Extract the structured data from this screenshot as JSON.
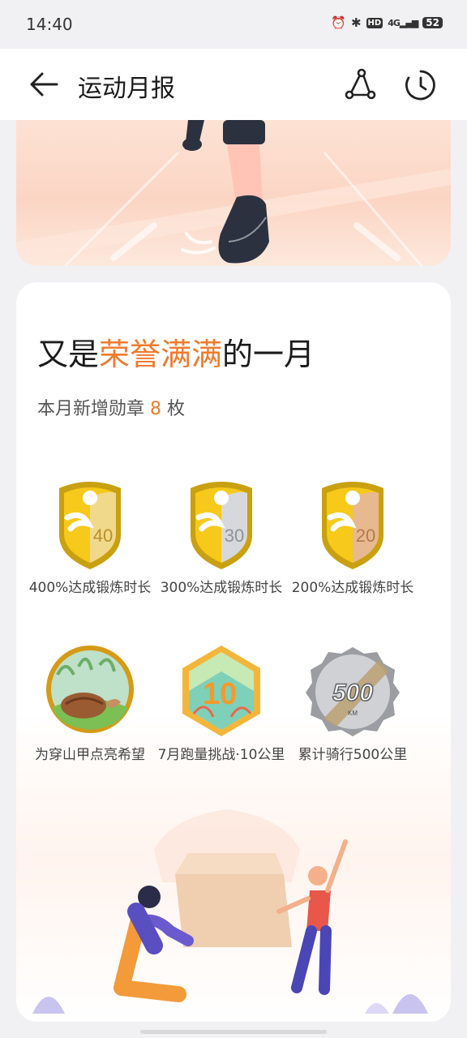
{
  "status_bar": {
    "time": "14:40",
    "hd": "HD",
    "network": "4G",
    "battery": "52",
    "icons": [
      "alarm-icon",
      "bluetooth-icon",
      "hd-icon",
      "signal-icon",
      "battery-icon"
    ]
  },
  "appbar": {
    "title": "运动月报",
    "back_icon": "arrow-left-icon",
    "share_icon": "share-icon",
    "history_icon": "history-icon"
  },
  "report": {
    "headline_prefix": "又是",
    "headline_highlight": "荣誉满满",
    "headline_suffix": "的一月",
    "sub_prefix": "本月新增勋章",
    "sub_count": "8",
    "sub_suffix": "枚",
    "accent_color": "#f07b2c"
  },
  "medals": [
    {
      "label": "400%达成锻炼时长",
      "badge_text": "40"
    },
    {
      "label": "300%达成锻炼时长",
      "badge_text": "30"
    },
    {
      "label": "200%达成锻炼时长",
      "badge_text": "20"
    },
    {
      "label": "为穿山甲点亮希望"
    },
    {
      "label": "7月跑量挑战·10公里",
      "badge_text": "10"
    },
    {
      "label": "累计骑行500公里",
      "badge_text": "500",
      "badge_unit": "KM"
    }
  ]
}
